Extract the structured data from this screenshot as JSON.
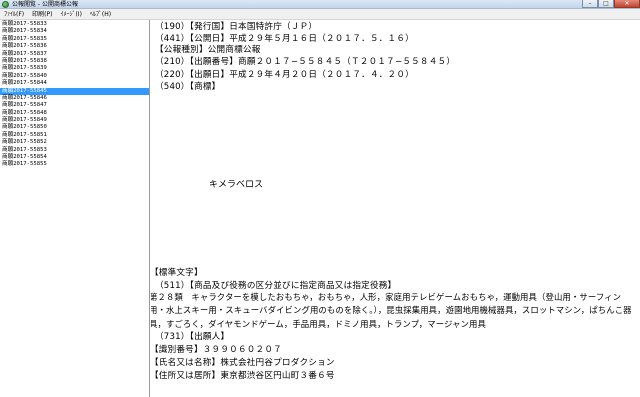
{
  "window": {
    "title": "公報閲覧 - 公開商標公報",
    "controls": {
      "minimize": "–",
      "maximize": "□",
      "close": "✕"
    }
  },
  "menu": [
    "ﾌｧｲﾙ(F)",
    "印刷(P)",
    "ｲﾒｰｼﾞ(I)",
    "ﾍﾙﾌﾟ(H)"
  ],
  "list": {
    "items": [
      "商願2017-55833",
      "商願2017-55834",
      "商願2017-55835",
      "商願2017-55836",
      "商願2017-55837",
      "商願2017-55838",
      "商願2017-55839",
      "商願2017-55840",
      "商願2017-55844",
      "商願2017-55845",
      "商願2017-55846",
      "商願2017-55847",
      "商願2017-55848",
      "商願2017-55849",
      "商願2017-55850",
      "商願2017-55851",
      "商願2017-55852",
      "商願2017-55853",
      "商願2017-55854",
      "商願2017-55855"
    ],
    "selected_index": 9
  },
  "document": {
    "header_lines": [
      "（190）【発行国】日本国特許庁（ＪＰ）",
      "（441）【公開日】平成２９年５月１６日（２０１７．５．１６）",
      "【公報種別】公開商標公報",
      "（210）【出願番号】商願２０１７−５５８４５（Ｔ２０１７−５５８４５）",
      "（220）【出願日】平成２９年４月２０日（２０１７．４．２０）",
      "（540）【商標】"
    ],
    "trademark_text": "キメラベロス",
    "footer_lines": [
      "【標準文字】",
      "（511）【商品及び役務の区分並びに指定商品又は指定役務】"
    ],
    "goods_paragraph": "第２８類　キャラクターを模したおもちゃ，おもちゃ，人形，家庭用テレビゲームおもちゃ，運動用具（登山用・サーフィン用・水上スキー用・スキューバダイビング用のものを除く。），昆虫採集用具，遊園地用機械器具，スロットマシン，ぱちんこ器具，すごろく，ダイヤモンドゲーム，手品用具，ドミノ用具，トランプ，マージャン用具",
    "applicant_lines": [
      "（731）【出願人】",
      "【識別番号】３９９０６０２０７",
      "【氏名又は名称】株式会社円谷プロダクション",
      "【住所又は居所】東京都渋谷区円山町３番６号"
    ]
  }
}
